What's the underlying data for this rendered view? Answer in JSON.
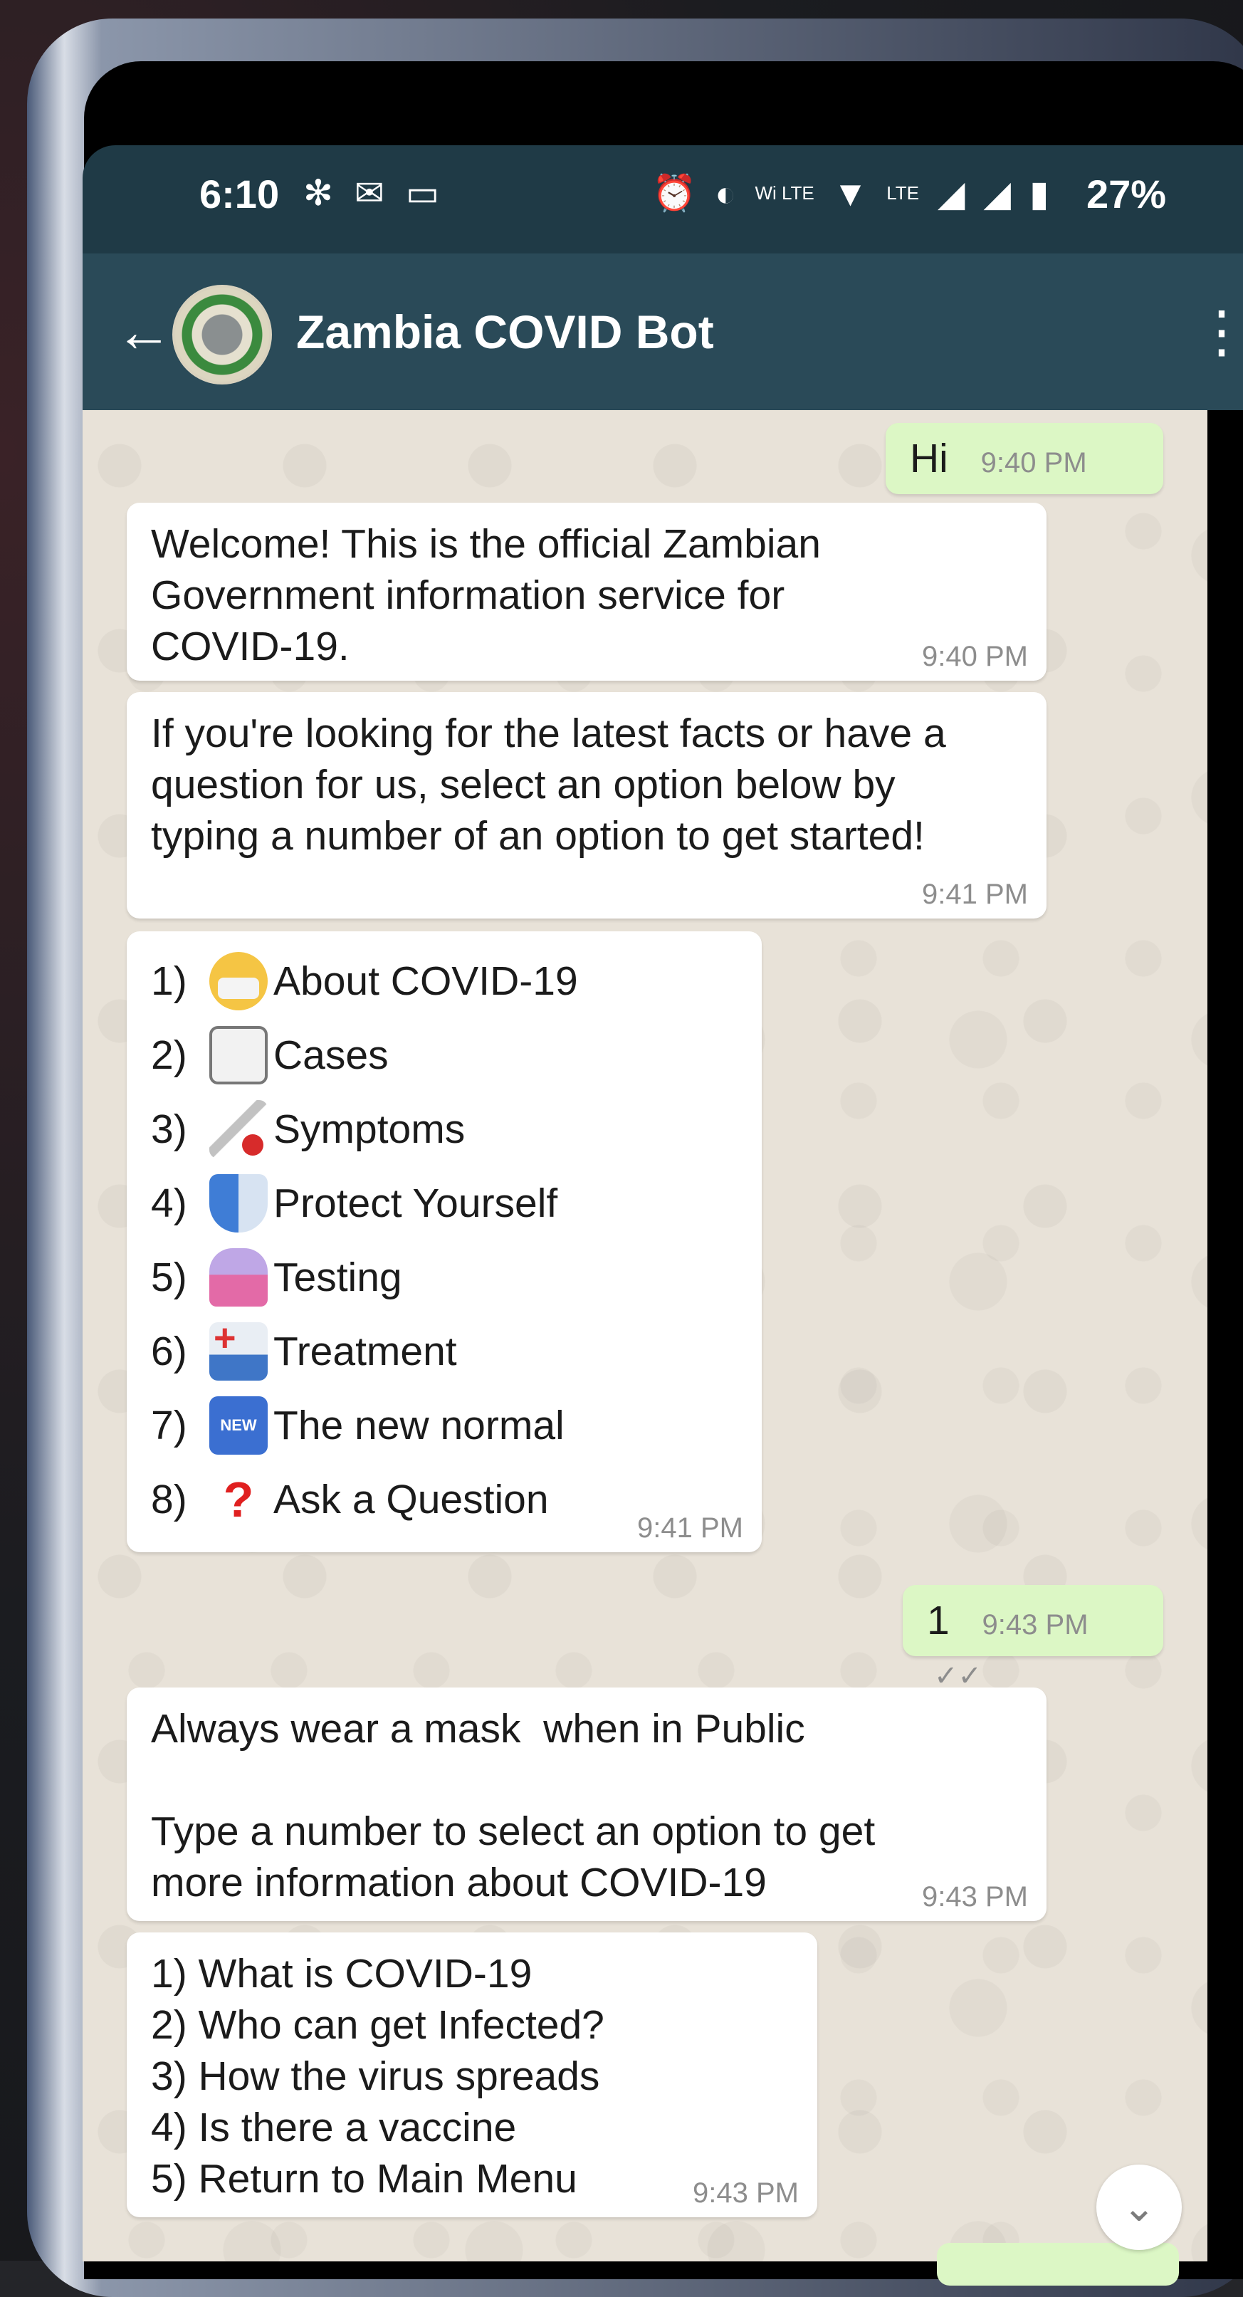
{
  "status_bar": {
    "time": "6:10",
    "battery": "27%",
    "left_icons": [
      "slack-icon",
      "gmail-icon",
      "laptop-icon"
    ],
    "right_icons": [
      "alarm-icon",
      "data-saver-icon",
      "volte-icon",
      "wifi-icon",
      "lte-signal-icon",
      "signal-icon",
      "battery-icon"
    ]
  },
  "app_bar": {
    "title": "Zambia COVID Bot",
    "back_glyph": "←",
    "menu_glyph": "⋮"
  },
  "messages": [
    {
      "direction": "out",
      "text": "Hi",
      "time": "9:40 PM",
      "ticks": "✓✓"
    },
    {
      "direction": "in",
      "lines": [
        "Welcome! This is the official Zambian",
        "Government information service for",
        "COVID-19."
      ],
      "time": "9:40 PM"
    },
    {
      "direction": "in",
      "lines": [
        "If you're looking for the latest facts or have a",
        "question for us, select an option below by",
        "typing a number of an option to get started!"
      ],
      "time": "9:41 PM"
    },
    {
      "direction": "in",
      "menu": [
        {
          "num": "1)",
          "icon": "face-mask-icon",
          "label": "About COVID-19"
        },
        {
          "num": "2)",
          "icon": "clipboard-icon",
          "label": "Cases"
        },
        {
          "num": "3)",
          "icon": "thermometer-icon",
          "label": "Symptoms"
        },
        {
          "num": "4)",
          "icon": "shield-icon",
          "label": "Protect Yourself"
        },
        {
          "num": "5)",
          "icon": "test-tube-icon",
          "label": "Testing"
        },
        {
          "num": "6)",
          "icon": "hospital-icon",
          "label": "Treatment"
        },
        {
          "num": "7)",
          "icon": "new-button-icon",
          "label": "The new normal",
          "badge": "NEW"
        },
        {
          "num": "8)",
          "icon": "question-mark-icon",
          "label": "Ask a Question",
          "glyph": "?"
        }
      ],
      "time": "9:41 PM"
    },
    {
      "direction": "out",
      "text": "1",
      "time": "9:43 PM",
      "ticks": "✓✓"
    },
    {
      "direction": "in",
      "lines": [
        "Always wear a mask  when in Public",
        "",
        "Type a number to select an option to get",
        "more information about COVID-19"
      ],
      "time": "9:43 PM"
    },
    {
      "direction": "in",
      "lines": [
        "1) What is COVID-19",
        "2) Who can get Infected?",
        "3) How the virus spreads",
        "4) Is there a vaccine",
        "5) Return to Main Menu"
      ],
      "time": "9:43 PM"
    }
  ],
  "scroll_down_glyph": "⌄",
  "colors": {
    "status_bar": "#1f3a46",
    "app_bar": "#2a4a58",
    "outgoing_bubble": "#dcf7c5",
    "incoming_bubble": "#ffffff",
    "chat_background": "#e8e2d8"
  }
}
